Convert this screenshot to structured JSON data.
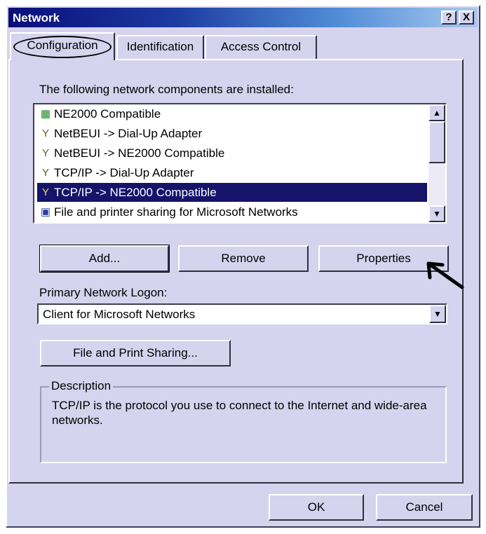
{
  "window": {
    "title": "Network",
    "help_btn": "?",
    "close_btn": "X"
  },
  "tabs": [
    {
      "label": "Configuration",
      "active": true
    },
    {
      "label": "Identification",
      "active": false
    },
    {
      "label": "Access Control",
      "active": false
    }
  ],
  "components": {
    "label": "The following network components are installed:",
    "items": [
      {
        "label": "NE2000 Compatible",
        "icon": "network-adapter-icon",
        "selected": false
      },
      {
        "label": "NetBEUI -> Dial-Up Adapter",
        "icon": "protocol-icon",
        "selected": false
      },
      {
        "label": "NetBEUI -> NE2000 Compatible",
        "icon": "protocol-icon",
        "selected": false
      },
      {
        "label": "TCP/IP -> Dial-Up Adapter",
        "icon": "protocol-icon",
        "selected": false
      },
      {
        "label": "TCP/IP -> NE2000 Compatible",
        "icon": "protocol-icon",
        "selected": true
      },
      {
        "label": "File and printer sharing for Microsoft Networks",
        "icon": "file-sharing-icon",
        "selected": false
      }
    ]
  },
  "buttons": {
    "add": "Add...",
    "remove": "Remove",
    "properties": "Properties",
    "file_print_sharing": "File and Print Sharing...",
    "ok": "OK",
    "cancel": "Cancel"
  },
  "logon": {
    "label": "Primary Network Logon:",
    "value": "Client for Microsoft Networks"
  },
  "description": {
    "legend": "Description",
    "text": "TCP/IP is the protocol you use to connect to the Internet and wide-area networks."
  },
  "colors": {
    "selection": "#15136a",
    "dialog_bg": "#d6d3ee",
    "title_start": "#0a0e78"
  }
}
